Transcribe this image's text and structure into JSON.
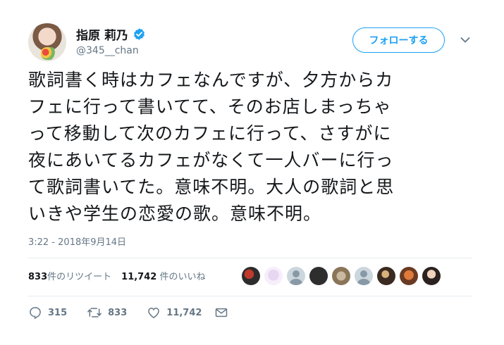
{
  "user": {
    "display_name": "指原 莉乃",
    "handle": "@345__chan",
    "verified": true
  },
  "follow_button_label": "フォローする",
  "tweet": {
    "text": "歌詞書く時はカフェなんですが、夕方からカ\nフェに行って書いてて、そのお店しまっちゃ\nって移動して次のカフェに行って、さすがに\n夜にあいてるカフェがなくて一人バーに行っ\nて歌詞書いてた。意味不明。大人の歌詞と思\nいきや学生の恋愛の歌。意味不明。",
    "timestamp": "3:22 - 2018年9月14日"
  },
  "stats": {
    "retweets_count": "833",
    "retweets_label": "件のリツイート",
    "likes_count": "11,742",
    "likes_label": " 件のいいね"
  },
  "actions": {
    "replies": "315",
    "retweets": "833",
    "likes": "11,742"
  },
  "colors": {
    "accent": "#1da1f2",
    "secondary_text": "#657786",
    "divider": "#e6ecf0"
  },
  "icons": [
    "verified-badge-icon",
    "chevron-down-icon",
    "reply-icon",
    "retweet-icon",
    "like-icon",
    "direct-message-icon"
  ]
}
